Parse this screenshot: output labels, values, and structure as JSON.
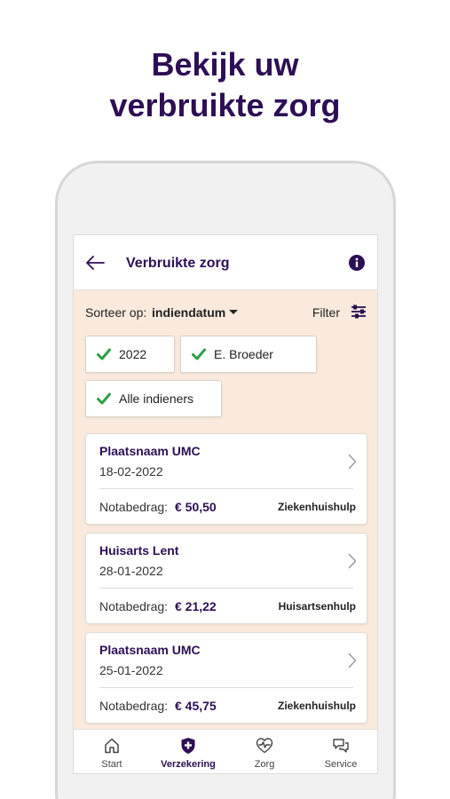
{
  "headline": {
    "line1": "Bekijk uw",
    "line2": "verbruikte zorg"
  },
  "colors": {
    "brand_purple": "#2d0f55",
    "background_beige": "#f9eadd",
    "check_green": "#2e9e48"
  },
  "app": {
    "title": "Verbruikte zorg",
    "back_icon": "arrow-left-icon",
    "info_icon": "info-icon"
  },
  "sort": {
    "label": "Sorteer op:",
    "value": "indiendatum",
    "filter_label": "Filter",
    "filter_icon": "sliders-icon"
  },
  "chips": [
    {
      "label": "2022",
      "checked": true
    },
    {
      "label": "E. Broeder",
      "checked": true
    },
    {
      "label": "Alle indieners",
      "checked": true
    }
  ],
  "claims": [
    {
      "name": "Plaatsnaam UMC",
      "date": "18-02-2022",
      "amount_label": "Notabedrag:",
      "amount": "€ 50,50",
      "category": "Ziekenhuishulp"
    },
    {
      "name": "Huisarts Lent",
      "date": "28-01-2022",
      "amount_label": "Notabedrag:",
      "amount": "€ 21,22",
      "category": "Huisartsenhulp"
    },
    {
      "name": "Plaatsnaam UMC",
      "date": "25-01-2022",
      "amount_label": "Notabedrag:",
      "amount": "€ 45,75",
      "category": "Ziekenhuishulp"
    }
  ],
  "tabs": [
    {
      "label": "Start",
      "icon": "home-icon",
      "active": false
    },
    {
      "label": "Verzekering",
      "icon": "shield-plus-icon",
      "active": true
    },
    {
      "label": "Zorg",
      "icon": "heart-pulse-icon",
      "active": false
    },
    {
      "label": "Service",
      "icon": "chat-bubbles-icon",
      "active": false
    }
  ]
}
